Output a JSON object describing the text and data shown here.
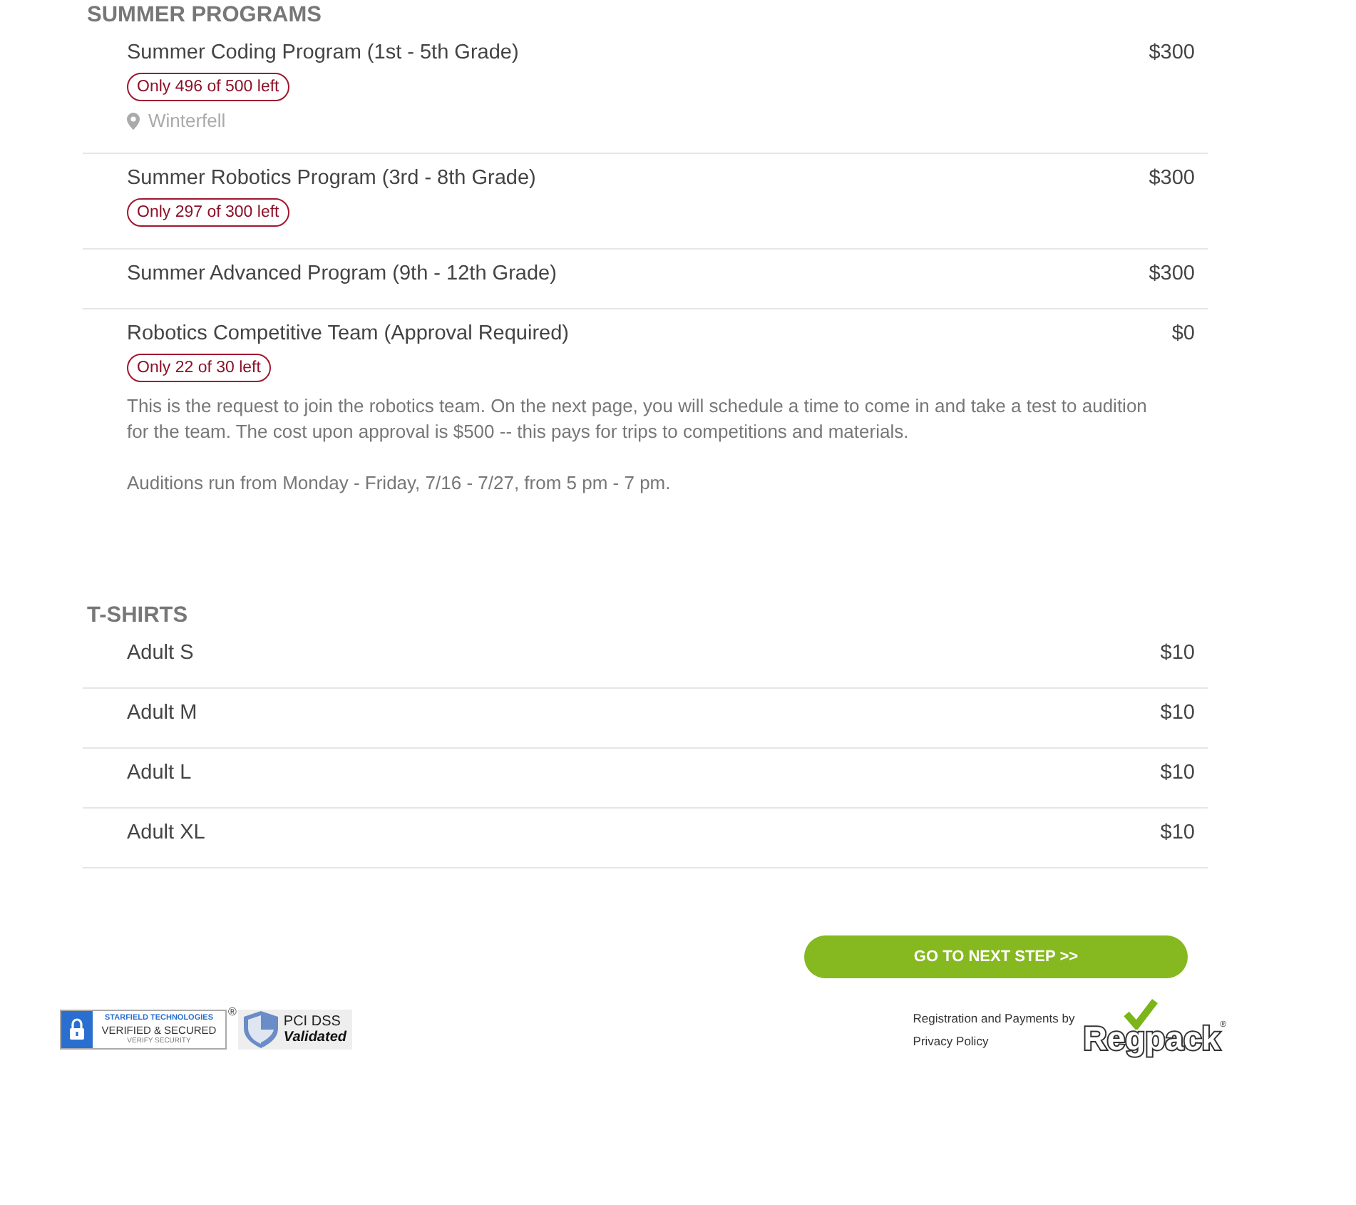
{
  "sections": [
    {
      "title": "SUMMER PROGRAMS",
      "items": [
        {
          "name": "Summer Coding Program (1st - 5th Grade)",
          "price": "$300",
          "availability": "Only 496 of 500 left",
          "location": "Winterfell"
        },
        {
          "name": "Summer Robotics Program (3rd - 8th Grade)",
          "price": "$300",
          "availability": "Only 297 of 300 left"
        },
        {
          "name": "Summer Advanced Program (9th - 12th Grade)",
          "price": "$300"
        },
        {
          "name": "Robotics Competitive Team (Approval Required)",
          "price": "$0",
          "availability": "Only 22 of 30 left",
          "description": [
            "This is the request to join the robotics team. On the next page, you will schedule a time to come in and take a test to audition for the team. The cost upon approval is $500 -- this pays for trips to competitions and materials.",
            "Auditions run from Monday - Friday, 7/16 - 7/27, from 5 pm - 7 pm."
          ]
        }
      ]
    },
    {
      "title": "T-SHIRTS",
      "items": [
        {
          "name": "Adult S",
          "price": "$10"
        },
        {
          "name": "Adult M",
          "price": "$10"
        },
        {
          "name": "Adult L",
          "price": "$10"
        },
        {
          "name": "Adult XL",
          "price": "$10"
        }
      ]
    }
  ],
  "next_button": "GO TO NEXT STEP >>",
  "footer": {
    "starfield": {
      "line1": "STARFIELD TECHNOLOGIES",
      "line2": "VERIFIED & SECURED",
      "line3": "VERIFY SECURITY",
      "mark": "®"
    },
    "pci": {
      "line1": "PCI DSS",
      "line2": "Validated"
    },
    "credit": "Registration and Payments by",
    "privacy": "Privacy Policy",
    "logo": "Regpack",
    "logo_mark": "®"
  }
}
